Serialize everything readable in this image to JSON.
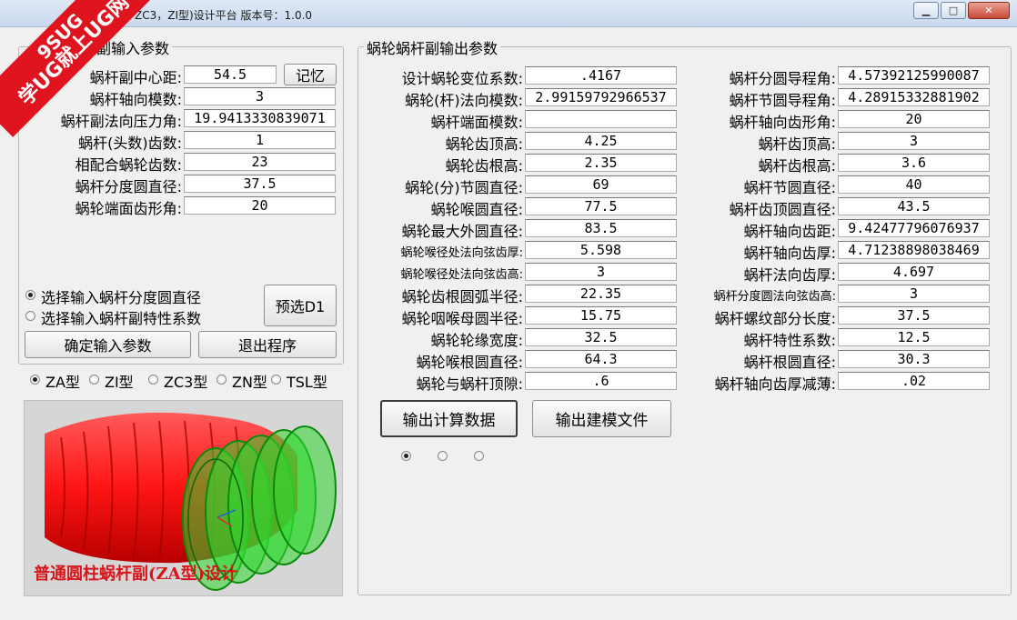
{
  "window": {
    "title": "ZC3，ZI型)设计平台  版本号：1.0.0",
    "minimize": "▁",
    "maximize": "□",
    "close": "✕"
  },
  "badge": {
    "line1": "9SUG",
    "line2": "学UG就上UG网"
  },
  "input_group": {
    "title": "副输入参数",
    "rows": [
      {
        "label": "蜗杆副中心距:",
        "value": "54.5"
      },
      {
        "label": "蜗杆轴向模数:",
        "value": "3"
      },
      {
        "label": "蜗杆副法向压力角:",
        "value": "19.9413330839071"
      },
      {
        "label": "蜗杆(头数)齿数:",
        "value": "1"
      },
      {
        "label": "相配合蜗轮齿数:",
        "value": "23"
      },
      {
        "label": "蜗杆分度圆直径:",
        "value": "37.5"
      },
      {
        "label": "蜗轮端面齿形角:",
        "value": "20"
      }
    ],
    "memory_button": "记忆",
    "radio1": "选择输入蜗杆分度圆直径",
    "radio2": "选择输入蜗杆副特性系数",
    "preselect_button": "预选D1",
    "confirm_button": "确定输入参数",
    "exit_button": "退出程序"
  },
  "type_options": [
    "ZA型",
    "ZI型",
    "ZC3型",
    "ZN型",
    "TSL型"
  ],
  "preview": {
    "caption": "普通圆柱蜗杆副(ZA型)设计"
  },
  "output_group": {
    "title": "蜗轮蜗杆副输出参数",
    "left": [
      {
        "label": "设计蜗轮变位系数:",
        "value": ".4167"
      },
      {
        "label": "蜗轮(杆)法向模数:",
        "value": "2.99159792966537"
      },
      {
        "label": "蜗杆端面模数:",
        "value": ""
      },
      {
        "label": "蜗轮齿顶高:",
        "value": "4.25"
      },
      {
        "label": "蜗轮齿根高:",
        "value": "2.35"
      },
      {
        "label": "蜗轮(分)节圆直径:",
        "value": "69"
      },
      {
        "label": "蜗轮喉圆直径:",
        "value": "77.5"
      },
      {
        "label": "蜗轮最大外圆直径:",
        "value": "83.5"
      },
      {
        "label": "蜗轮喉径处法向弦齿厚:",
        "value": "5.598"
      },
      {
        "label": "蜗轮喉径处法向弦齿高:",
        "value": "3"
      },
      {
        "label": "蜗轮齿根圆弧半径:",
        "value": "22.35"
      },
      {
        "label": "蜗轮咽喉母圆半径:",
        "value": "15.75"
      },
      {
        "label": "蜗轮轮缘宽度:",
        "value": "32.5"
      },
      {
        "label": "蜗轮喉根圆直径:",
        "value": "64.3"
      },
      {
        "label": "蜗轮与蜗杆顶隙:",
        "value": ".6"
      }
    ],
    "right": [
      {
        "label": "蜗杆分圆导程角:",
        "value": "4.57392125990087"
      },
      {
        "label": "蜗杆节圆导程角:",
        "value": "4.28915332881902"
      },
      {
        "label": "蜗杆轴向齿形角:",
        "value": "20"
      },
      {
        "label": "蜗杆齿顶高:",
        "value": "3"
      },
      {
        "label": "蜗杆齿根高:",
        "value": "3.6"
      },
      {
        "label": "蜗杆节圆直径:",
        "value": "40"
      },
      {
        "label": "蜗杆齿顶圆直径:",
        "value": "43.5"
      },
      {
        "label": "蜗杆轴向齿距:",
        "value": "9.42477796076937"
      },
      {
        "label": "蜗杆轴向齿厚:",
        "value": "4.71238898038469"
      },
      {
        "label": "蜗杆法向齿厚:",
        "value": "4.697"
      },
      {
        "label": "蜗杆分度圆法向弦齿高:",
        "value": "3"
      },
      {
        "label": "蜗杆螺纹部分长度:",
        "value": "37.5"
      },
      {
        "label": "蜗杆特性系数:",
        "value": "12.5"
      },
      {
        "label": "蜗杆根圆直径:",
        "value": "30.3"
      },
      {
        "label": "蜗杆轴向齿厚减薄:",
        "value": ".02"
      }
    ],
    "calc_button": "输出计算数据",
    "model_button": "输出建模文件"
  },
  "colors": {
    "gear_red": "#ff1a1a",
    "worm_green": "#2fd92f",
    "caption_red": "#d8151b",
    "badge_red": "#e0141e"
  }
}
